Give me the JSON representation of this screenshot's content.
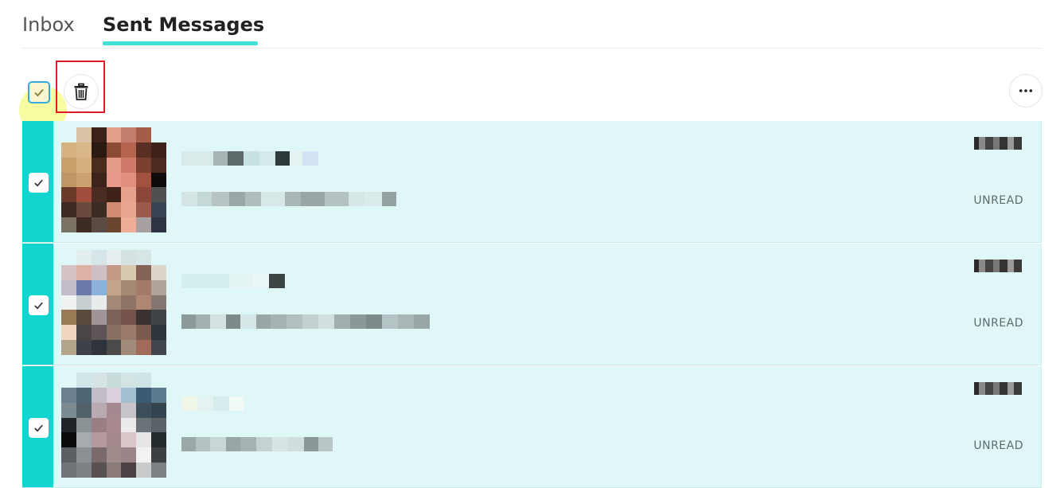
{
  "tabs": [
    {
      "label": "Inbox",
      "active": false
    },
    {
      "label": "Sent Messages",
      "active": true
    }
  ],
  "toolbar": {
    "select_all_checked": true,
    "delete_icon": "trash-icon",
    "more_icon": "more-horizontal-icon"
  },
  "messages": [
    {
      "status": "UNREAD",
      "checked": true
    },
    {
      "status": "UNREAD",
      "checked": true
    },
    {
      "status": "UNREAD",
      "checked": true
    }
  ],
  "colors": {
    "accent": "#12d5cf",
    "tab_underline": "#3ee0d8",
    "row_background": "#dff8f7",
    "highlight_box": "#e11b26"
  }
}
